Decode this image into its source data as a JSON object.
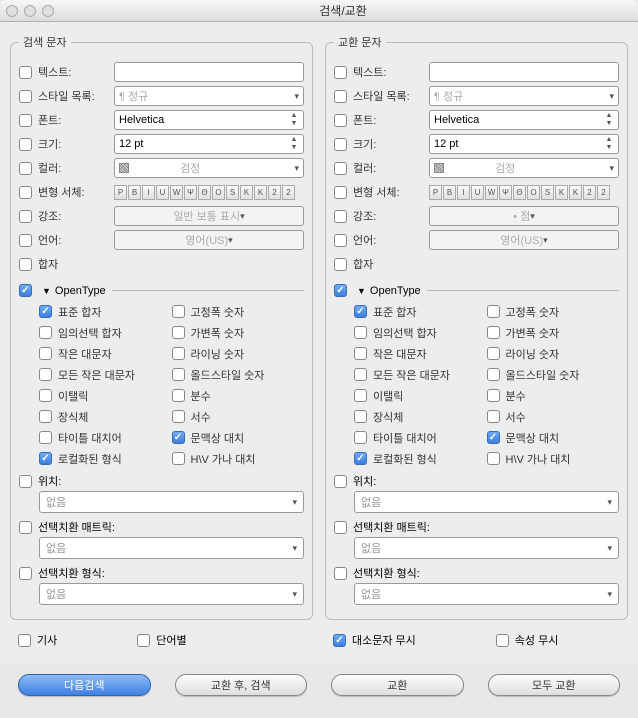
{
  "title": "검색/교환",
  "left": {
    "legend": "검색 문자",
    "rows": [
      {
        "k": "text_enable",
        "lbl": "텍스트:",
        "type": "text",
        "cb": false
      },
      {
        "k": "style",
        "lbl": "스타일 목록:",
        "type": "drop",
        "val": "¶ 정규",
        "cb": false,
        "ph": true
      },
      {
        "k": "font",
        "lbl": "폰트:",
        "type": "step",
        "val": "Helvetica",
        "cb": false
      },
      {
        "k": "size",
        "lbl": "크기:",
        "type": "step",
        "val": "12 pt",
        "cb": false
      },
      {
        "k": "color",
        "lbl": "컬러:",
        "type": "drop",
        "val": "검정",
        "sw": true,
        "cb": false,
        "ph": true
      },
      {
        "k": "typeface",
        "lbl": "변형 서체:",
        "type": "style",
        "cb": false
      },
      {
        "k": "emph",
        "lbl": "강조:",
        "type": "drop",
        "val": "일반 보통 표시",
        "cb": false,
        "dis": true
      },
      {
        "k": "lang",
        "lbl": "언어:",
        "type": "drop",
        "val": "영어(US)",
        "cb": false,
        "dis": true
      },
      {
        "k": "lig",
        "lbl": "합자",
        "type": "none",
        "cb": false
      }
    ],
    "opentype_label": "OpenType",
    "opentype_cb": true,
    "ot_left": [
      {
        "l": "표준 합자",
        "c": true
      },
      {
        "l": "임의선택 합자",
        "c": false
      },
      {
        "l": "작은 대문자",
        "c": false
      },
      {
        "l": "모든 작은 대문자",
        "c": false
      },
      {
        "l": "이탤릭",
        "c": false
      },
      {
        "l": "장식체",
        "c": false
      },
      {
        "l": "타이틀 대치어",
        "c": false
      },
      {
        "l": "로컬화된 형식",
        "c": true
      }
    ],
    "ot_right": [
      {
        "l": "고정폭 숫자",
        "c": false
      },
      {
        "l": "가변폭 숫자",
        "c": false
      },
      {
        "l": "라이닝 숫자",
        "c": false
      },
      {
        "l": "올드스타일 숫자",
        "c": false
      },
      {
        "l": "분수",
        "c": false
      },
      {
        "l": "서수",
        "c": false
      },
      {
        "l": "문맥상 대치",
        "c": true
      },
      {
        "l": "H\\V 가나 대치",
        "c": false
      }
    ],
    "pos_lbl": "위치:",
    "pos_val": "없음",
    "mat_lbl": "선택치환 매트릭:",
    "mat_val": "없음",
    "fmt_lbl": "선택치환 형식:",
    "fmt_val": "없음",
    "bottom": [
      {
        "l": "기사",
        "c": false
      },
      {
        "l": "단어별",
        "c": false
      }
    ]
  },
  "right": {
    "legend": "교환 문자",
    "rows": [
      {
        "k": "text_enable",
        "lbl": "텍스트:",
        "type": "text",
        "cb": false
      },
      {
        "k": "style",
        "lbl": "스타일 목록:",
        "type": "drop",
        "val": "¶ 정규",
        "cb": false,
        "ph": true
      },
      {
        "k": "font",
        "lbl": "폰트:",
        "type": "step",
        "val": "Helvetica",
        "cb": false
      },
      {
        "k": "size",
        "lbl": "크기:",
        "type": "step",
        "val": "12 pt",
        "cb": false
      },
      {
        "k": "color",
        "lbl": "컬러:",
        "type": "drop",
        "val": "검정",
        "sw": true,
        "cb": false,
        "ph": true
      },
      {
        "k": "typeface",
        "lbl": "변형 서체:",
        "type": "style",
        "cb": false
      },
      {
        "k": "emph",
        "lbl": "강조:",
        "type": "drop",
        "val": "• 점",
        "cb": false,
        "dis": true
      },
      {
        "k": "lang",
        "lbl": "언어:",
        "type": "drop",
        "val": "영어(US)",
        "cb": false,
        "dis": true
      },
      {
        "k": "lig",
        "lbl": "합자",
        "type": "none",
        "cb": false
      }
    ],
    "opentype_label": "OpenType",
    "opentype_cb": true,
    "ot_left": [
      {
        "l": "표준 합자",
        "c": true
      },
      {
        "l": "임의선택 합자",
        "c": false
      },
      {
        "l": "작은 대문자",
        "c": false
      },
      {
        "l": "모든 작은 대문자",
        "c": false
      },
      {
        "l": "이탤릭",
        "c": false
      },
      {
        "l": "장식체",
        "c": false
      },
      {
        "l": "타이틀 대치어",
        "c": false
      },
      {
        "l": "로컬화된 형식",
        "c": true
      }
    ],
    "ot_right": [
      {
        "l": "고정폭 숫자",
        "c": false
      },
      {
        "l": "가변폭 숫자",
        "c": false
      },
      {
        "l": "라이닝 숫자",
        "c": false
      },
      {
        "l": "올드스타일 숫자",
        "c": false
      },
      {
        "l": "분수",
        "c": false
      },
      {
        "l": "서수",
        "c": false
      },
      {
        "l": "문맥상 대치",
        "c": true
      },
      {
        "l": "H\\V 가나 대치",
        "c": false
      }
    ],
    "pos_lbl": "위치:",
    "pos_val": "없음",
    "mat_lbl": "선택치환 매트릭:",
    "mat_val": "없음",
    "fmt_lbl": "선택치환 형식:",
    "fmt_val": "없음",
    "bottom": [
      {
        "l": "대소문자 무시",
        "c": true
      },
      {
        "l": "속성 무시",
        "c": false
      }
    ]
  },
  "typestyle_btns": [
    "P",
    "B",
    "I",
    "U",
    "W",
    "Ψ",
    "Θ",
    "O",
    "S",
    "K",
    "K",
    "2",
    "2"
  ],
  "buttons": [
    "다음검색",
    "교환 후, 검색",
    "교환",
    "모두 교환"
  ]
}
